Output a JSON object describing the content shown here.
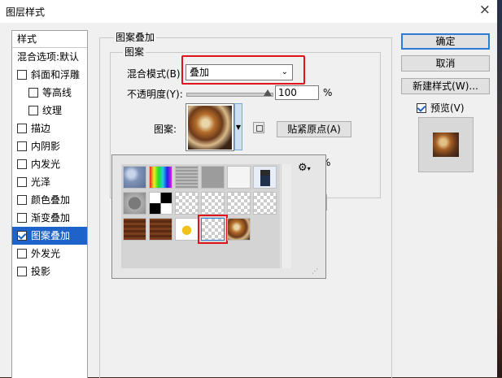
{
  "window": {
    "title": "图层样式",
    "close_glyph": "×"
  },
  "sidebar": {
    "header": "样式",
    "items": [
      {
        "label": "混合选项:默认",
        "checkbox": false,
        "checked": false,
        "indent": false,
        "active": false
      },
      {
        "label": "斜面和浮雕",
        "checkbox": true,
        "checked": false,
        "indent": false,
        "active": false
      },
      {
        "label": "等高线",
        "checkbox": true,
        "checked": false,
        "indent": true,
        "active": false
      },
      {
        "label": "纹理",
        "checkbox": true,
        "checked": false,
        "indent": true,
        "active": false
      },
      {
        "label": "描边",
        "checkbox": true,
        "checked": false,
        "indent": false,
        "active": false
      },
      {
        "label": "内阴影",
        "checkbox": true,
        "checked": false,
        "indent": false,
        "active": false
      },
      {
        "label": "内发光",
        "checkbox": true,
        "checked": false,
        "indent": false,
        "active": false
      },
      {
        "label": "光泽",
        "checkbox": true,
        "checked": false,
        "indent": false,
        "active": false
      },
      {
        "label": "颜色叠加",
        "checkbox": true,
        "checked": false,
        "indent": false,
        "active": false
      },
      {
        "label": "渐变叠加",
        "checkbox": true,
        "checked": false,
        "indent": false,
        "active": false
      },
      {
        "label": "图案叠加",
        "checkbox": true,
        "checked": true,
        "indent": false,
        "active": true
      },
      {
        "label": "外发光",
        "checkbox": true,
        "checked": false,
        "indent": false,
        "active": false
      },
      {
        "label": "投影",
        "checkbox": true,
        "checked": false,
        "indent": false,
        "active": false
      }
    ]
  },
  "panel": {
    "group_title": "图案叠加",
    "subgroup_title": "图案",
    "blend_mode_label": "混合模式(B):",
    "blend_mode_value": "叠加",
    "opacity_label": "不透明度(Y):",
    "opacity_value": "100",
    "opacity_fraction": 1.0,
    "percent": "%",
    "percent2": "%",
    "pattern_label": "图案:",
    "snap_button": "贴紧原点(A)",
    "new_pattern_icon": "new-preset-icon",
    "gear_icon": "⚙",
    "gear_caret": "▾",
    "caret": "⌄",
    "picker_arrow": "▼"
  },
  "pattern_picker": {
    "selected_index": 15,
    "tiles": [
      "bubbles",
      "rainbow",
      "noise-grey",
      "grey",
      "transparent",
      "id-photo",
      "stone-circle",
      "black-white",
      "checker",
      "checker",
      "ink",
      "sketch",
      "wood",
      "wood",
      "fruit",
      "splatter",
      "rust"
    ]
  },
  "buttons": {
    "ok": "确定",
    "cancel": "取消",
    "new_style": "新建样式(W)...",
    "preview_label": "预览(V)",
    "preview_checked": true
  },
  "colors": {
    "accent": "#1e63c9",
    "highlight_red": "#e0121c"
  }
}
